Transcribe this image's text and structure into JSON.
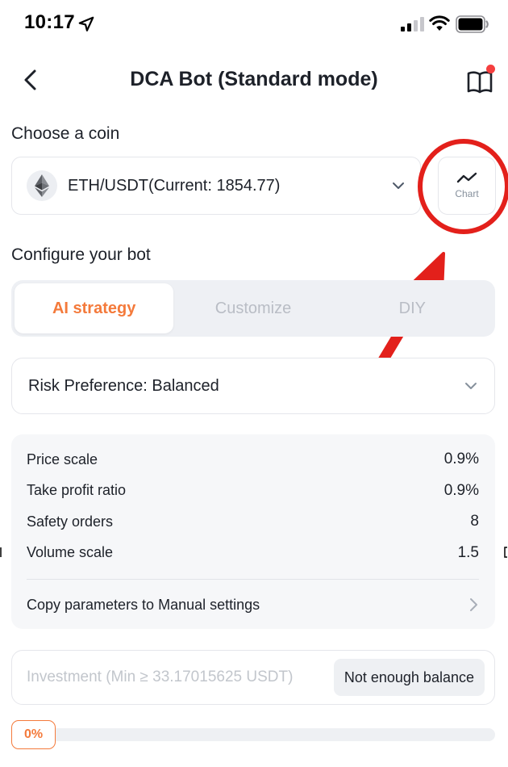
{
  "status_bar": {
    "time": "10:17"
  },
  "header": {
    "title": "DCA Bot (Standard mode)"
  },
  "coin_section": {
    "title": "Choose a coin",
    "selected_coin": "ETH/USDT(Current: 1854.77)",
    "chart_button_label": "Chart"
  },
  "config_section": {
    "title": "Configure your bot",
    "tabs": [
      {
        "label": "AI strategy",
        "active": true
      },
      {
        "label": "Customize",
        "active": false
      },
      {
        "label": "DIY",
        "active": false
      }
    ]
  },
  "risk": {
    "label": "Risk Preference: Balanced"
  },
  "params": {
    "rows": [
      {
        "label": "Price scale",
        "value": "0.9%"
      },
      {
        "label": "Take profit ratio",
        "value": "0.9%"
      },
      {
        "label": "Safety orders",
        "value": "8"
      },
      {
        "label": "Volume scale",
        "value": "1.5"
      }
    ],
    "copy_label": "Copy parameters to Manual settings"
  },
  "investment": {
    "placeholder": "Investment (Min ≥ 33.17015625 USDT)",
    "value": "",
    "balance_button": "Not enough balance"
  },
  "slider": {
    "percent_label": "0%",
    "fraction": 0
  },
  "colors": {
    "accent": "#f47a3b",
    "annotation_red": "#e3201b",
    "notification_dot": "#f53f3f"
  },
  "icons": [
    "location-arrow-icon",
    "signal-icon",
    "wifi-icon",
    "battery-icon",
    "back-icon",
    "book-icon",
    "eth-icon",
    "chevron-down-icon",
    "chart-line-icon",
    "chevron-right-icon"
  ]
}
